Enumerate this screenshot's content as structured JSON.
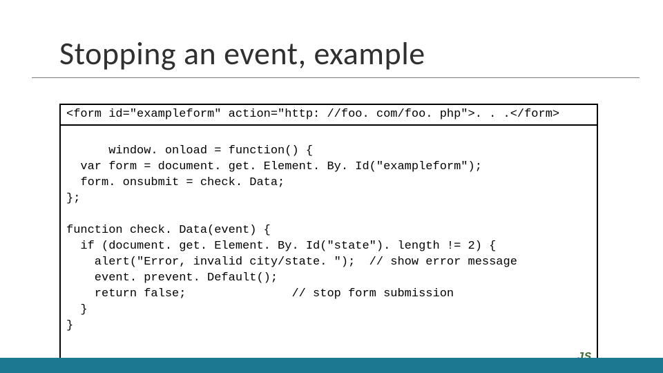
{
  "title": "Stopping an event, example",
  "code_box_1": "<form id=\"exampleform\" action=\"http: //foo. com/foo. php\">. . .</form>",
  "code_box_2": "window. onload = function() {\n  var form = document. get. Element. By. Id(\"exampleform\");\n  form. onsubmit = check. Data;\n};\n\nfunction check. Data(event) {\n  if (document. get. Element. By. Id(\"state\"). length != 2) {\n    alert(\"Error, invalid city/state. \");  // show error message\n    event. prevent. Default();\n    return false;               // stop form submission\n  }\n}",
  "js_label": "JS"
}
